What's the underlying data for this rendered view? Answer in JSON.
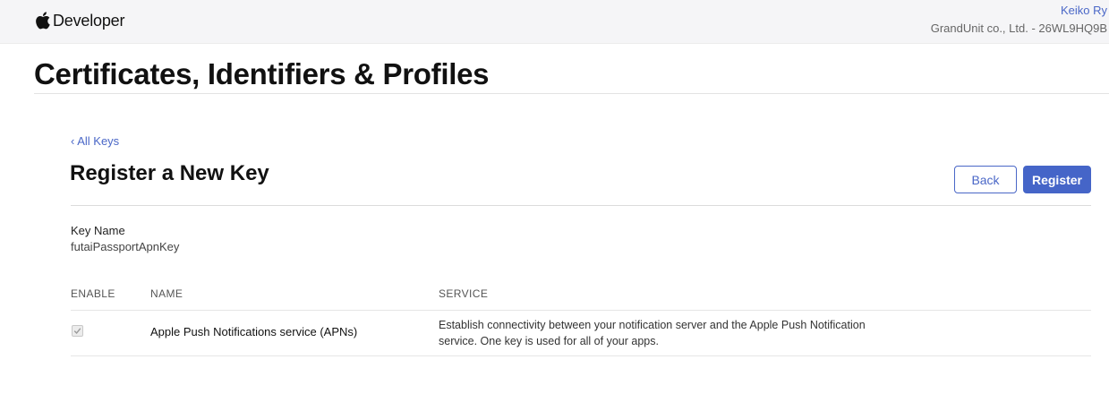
{
  "header": {
    "brand_icon": "apple-logo-icon",
    "brand_label": "Developer",
    "user_name": "Keiko Ry",
    "team_name": "GrandUnit co., Ltd. - 26WL9HQ9B"
  },
  "page": {
    "title": "Certificates, Identifiers & Profiles"
  },
  "section": {
    "back_link": "‹ All Keys",
    "title": "Register a New Key",
    "back_button": "Back",
    "register_button": "Register"
  },
  "key": {
    "label": "Key Name",
    "value": "futaiPassportApnKey"
  },
  "table": {
    "headers": [
      "ENABLE",
      "NAME",
      "SERVICE"
    ],
    "rows": [
      {
        "enabled": true,
        "name": "Apple Push Notifications service (APNs)",
        "service": "Establish connectivity between your notification server and the Apple Push Notification service. One key is used for all of your apps."
      }
    ]
  },
  "colors": {
    "accent": "#4565c8",
    "link": "#4a67c7"
  }
}
